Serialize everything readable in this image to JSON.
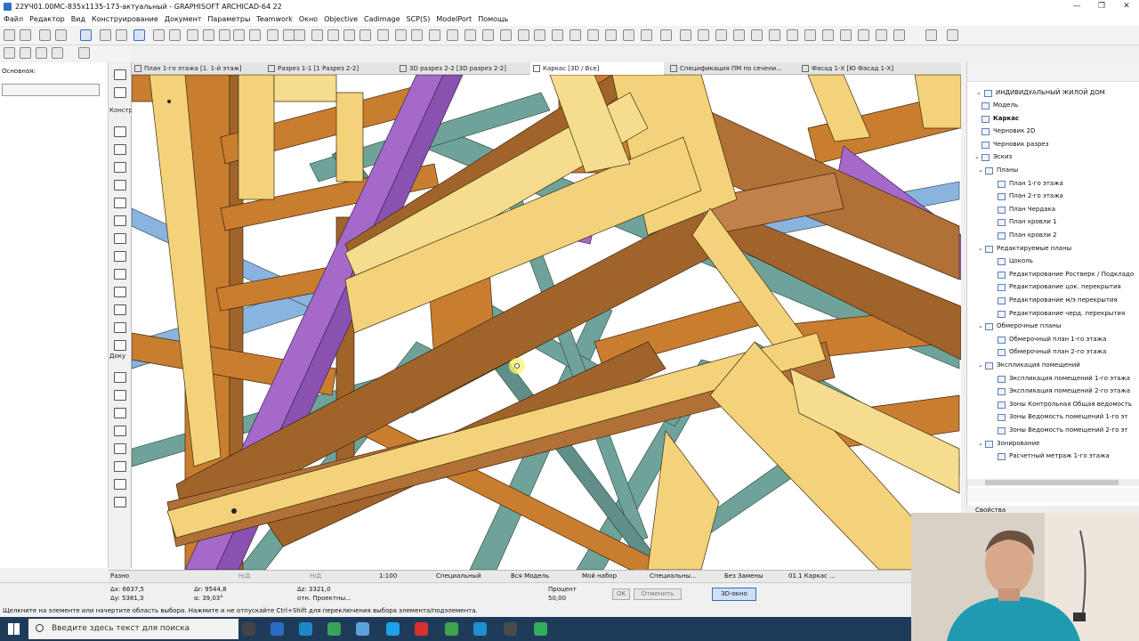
{
  "window": {
    "title": "22УЧ01.00МС-835х1135-173-актуальный - GRAPHISOFT ARCHICAD-64 22"
  },
  "menu": [
    "Файл",
    "Редактор",
    "Вид",
    "Конструирование",
    "Документ",
    "Параметры",
    "Teamwork",
    "Окно",
    "Objective",
    "Cadimage",
    "SCP(S)",
    "ModelPort",
    "Помощь"
  ],
  "info_box": {
    "label": "Основная:"
  },
  "toolbox": {
    "section_construct": "Констр",
    "section_document": "Доку",
    "section_misc": "Разно"
  },
  "tabs": [
    {
      "label": "План 1-го этажа [1. 1-й этаж]"
    },
    {
      "label": "Разрез 1-1 [1 Разрез 2-2]"
    },
    {
      "label": "3D разрез 2-2 [3D разрез 2-2]"
    },
    {
      "label": "Каркас [3D / Все]"
    },
    {
      "label": "Спецификация ПМ по сечени..."
    },
    {
      "label": "Фасад 1-X [Ю Фасад 1-X]"
    }
  ],
  "navigator": {
    "root": "ИНДИВИДУАЛЬНЫЙ ЖИЛОЙ ДОМ",
    "items": [
      {
        "label": "Модель",
        "level": 1,
        "type": "view"
      },
      {
        "label": "Каркас",
        "level": 1,
        "type": "view",
        "bold": true
      },
      {
        "label": "Черновик 2D",
        "level": 1,
        "type": "view"
      },
      {
        "label": "Черновик разрез",
        "level": 1,
        "type": "view"
      },
      {
        "label": "Эскиз",
        "level": 1,
        "type": "folder"
      },
      {
        "label": "Планы",
        "level": 2,
        "type": "folder"
      },
      {
        "label": "План 1-го этажа",
        "level": 3,
        "type": "view"
      },
      {
        "label": "План 2-го этажа",
        "level": 3,
        "type": "view"
      },
      {
        "label": "План Чердака",
        "level": 3,
        "type": "view"
      },
      {
        "label": "План кровли 1",
        "level": 3,
        "type": "view"
      },
      {
        "label": "План кровли 2",
        "level": 3,
        "type": "view"
      },
      {
        "label": "Редактируемые планы",
        "level": 2,
        "type": "folder"
      },
      {
        "label": "Цоколь",
        "level": 3,
        "type": "view"
      },
      {
        "label": "Редактирование Ростверк / Подкладо",
        "level": 3,
        "type": "view"
      },
      {
        "label": "Редактирование цок. перекрытия",
        "level": 3,
        "type": "view"
      },
      {
        "label": "Редактирование м/э перекрытия",
        "level": 3,
        "type": "view"
      },
      {
        "label": "Редактирование черд. перекрытия",
        "level": 3,
        "type": "view"
      },
      {
        "label": "Обмерочные планы",
        "level": 2,
        "type": "folder"
      },
      {
        "label": "Обмерочный план 1-го этажа",
        "level": 3,
        "type": "view"
      },
      {
        "label": "Обмерочный план 2-го этажа",
        "level": 3,
        "type": "view"
      },
      {
        "label": "Экспликация помещений",
        "level": 2,
        "type": "folder"
      },
      {
        "label": "Экспликация помещений 1-го этажа",
        "level": 3,
        "type": "view"
      },
      {
        "label": "Экспликация помещений 2-го этажа",
        "level": 3,
        "type": "view"
      },
      {
        "label": "Зоны Контрольная Общая ведомость",
        "level": 3,
        "type": "table"
      },
      {
        "label": "Зоны Ведомость помещений 1-го эт",
        "level": 3,
        "type": "table"
      },
      {
        "label": "Зоны Ведомость помещений 2-го эт",
        "level": 3,
        "type": "table"
      },
      {
        "label": "Зонирование",
        "level": 2,
        "type": "folder"
      },
      {
        "label": "Расчетный метраж 1-го этажа",
        "level": 3,
        "type": "view"
      }
    ],
    "properties_label": "Свойства"
  },
  "status": {
    "nd": "Н/Д",
    "scale": "1:100",
    "layer_combo": "Специальный",
    "model_filter": "Вся Модель",
    "pen_set": "Мой набор",
    "model_view": "Специальны...",
    "renovation": "Без Замены",
    "view_name": "01.1 Каркас ..."
  },
  "coords": {
    "ax": "Δx: 6637,5",
    "ay": "Δy: 5381,3",
    "ar": "Δr: 9544,8",
    "aa": "α: 39,03°",
    "az": "Δz: 3321,0",
    "ref": "отн. Проектны...",
    "percent_label": "Процент",
    "percent_value": "50,00",
    "ok": "OK",
    "cancel": "Отменить",
    "window3d": "3D-окно"
  },
  "hint": "Щелкните на элементе или начертите область выбора. Нажмите и не отпускайте Ctrl+Shift для переключения выбора элемента/подэлемента.",
  "taskbar": {
    "search_placeholder": "Введите здесь текст для поиска"
  },
  "colors": {
    "beam_yellow": "#f3d27a",
    "beam_orange": "#c97d2f",
    "beam_brown": "#a0642b",
    "beam_purple": "#a469c9",
    "frame_teal": "#6fa39a",
    "frame_blue": "#8ab4e0"
  }
}
